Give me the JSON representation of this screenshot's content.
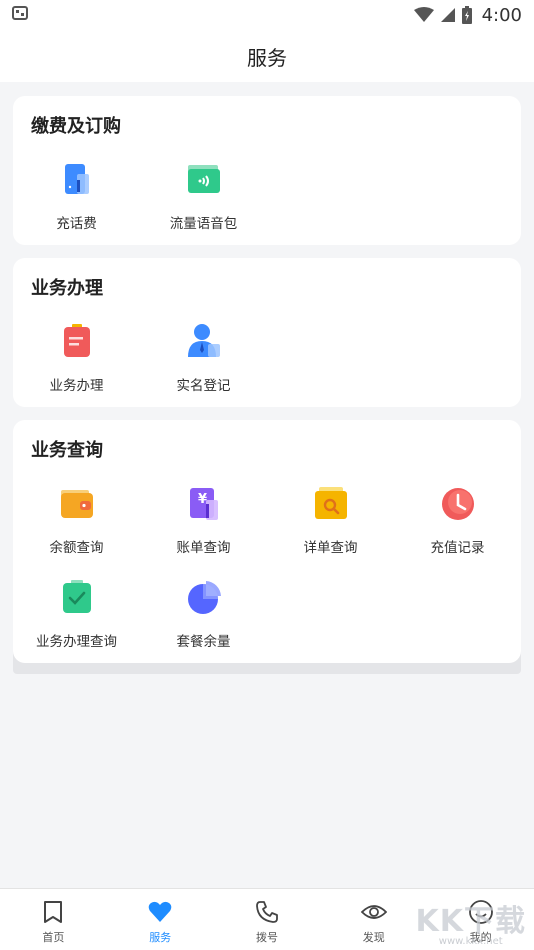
{
  "status_bar": {
    "time": "4:00",
    "left_icon": "app-notification-icon"
  },
  "header": {
    "title": "服务"
  },
  "sections": [
    {
      "title": "缴费及订购",
      "items": [
        {
          "label": "充话费",
          "icon": "phone-recharge-icon",
          "color": "#3d8bff"
        },
        {
          "label": "流量语音包",
          "icon": "data-voice-pack-icon",
          "color": "#2fc98b"
        }
      ]
    },
    {
      "title": "业务办理",
      "items": [
        {
          "label": "业务办理",
          "icon": "clipboard-icon",
          "color": "#f05a5a"
        },
        {
          "label": "实名登记",
          "icon": "user-id-icon",
          "color": "#3d8bff"
        }
      ]
    },
    {
      "title": "业务查询",
      "items": [
        {
          "label": "余额查询",
          "icon": "wallet-icon",
          "color": "#f5a623"
        },
        {
          "label": "账单查询",
          "icon": "bill-yuan-icon",
          "color": "#8a5cf5"
        },
        {
          "label": "详单查询",
          "icon": "detail-search-icon",
          "color": "#f5b400"
        },
        {
          "label": "充值记录",
          "icon": "clock-icon",
          "color": "#f05a5a"
        },
        {
          "label": "业务办理查询",
          "icon": "check-clipboard-icon",
          "color": "#2fc98b"
        },
        {
          "label": "套餐余量",
          "icon": "pie-chart-icon",
          "color": "#5566ff"
        }
      ]
    }
  ],
  "bottom_nav": [
    {
      "label": "首页",
      "icon": "bookmark-icon",
      "active": false
    },
    {
      "label": "服务",
      "icon": "heart-icon",
      "active": true
    },
    {
      "label": "拨号",
      "icon": "phone-icon",
      "active": false
    },
    {
      "label": "发现",
      "icon": "eye-icon",
      "active": false
    },
    {
      "label": "我的",
      "icon": "smile-icon",
      "active": false
    }
  ],
  "watermark": {
    "main": "KK下载",
    "sub": "www.kkx.net"
  },
  "colors": {
    "accent": "#1e8cff",
    "background": "#f4f5f7"
  }
}
